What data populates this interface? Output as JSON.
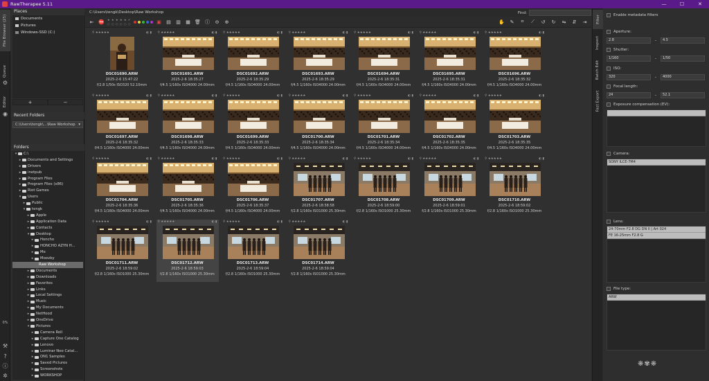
{
  "window": {
    "title": "RawTherapee 5.11",
    "minimize": "—",
    "maximize": "☐",
    "close": "✕"
  },
  "left_tabs": [
    "File Browser (25)",
    "Queue",
    "Editor"
  ],
  "right_tabs": [
    "Filter",
    "Inspect",
    "Batch Edit",
    "Fast Export"
  ],
  "places": {
    "title": "Places",
    "items": [
      "Documents",
      "Pictures",
      "Windows-SSD (C:)"
    ],
    "add": "+",
    "remove": "−"
  },
  "recent": {
    "title": "Recent Folders",
    "value": "C:\\Users\\tengk\\...\\Raw Workshop"
  },
  "folders": {
    "title": "Folders",
    "tree": [
      {
        "label": "C:\\",
        "indent": 0,
        "open": true
      },
      {
        "label": "Documents and Settings",
        "indent": 1
      },
      {
        "label": "Drivers",
        "indent": 1
      },
      {
        "label": "inetpub",
        "indent": 1
      },
      {
        "label": "Program Files",
        "indent": 1
      },
      {
        "label": "Program Files (x86)",
        "indent": 1
      },
      {
        "label": "Riot Games",
        "indent": 1
      },
      {
        "label": "Users",
        "indent": 1,
        "open": true
      },
      {
        "label": "Public",
        "indent": 2
      },
      {
        "label": "tengk",
        "indent": 2,
        "open": true
      },
      {
        "label": "Apple",
        "indent": 3
      },
      {
        "label": "Application Data",
        "indent": 3
      },
      {
        "label": "Contacts",
        "indent": 3
      },
      {
        "label": "Desktop",
        "indent": 3,
        "open": true
      },
      {
        "label": "Honcho",
        "indent": 4
      },
      {
        "label": "HONCHO AZYN H...",
        "indent": 4
      },
      {
        "label": "Me",
        "indent": 4
      },
      {
        "label": "Moovby",
        "indent": 4
      },
      {
        "label": "Raw Workshop",
        "indent": 5,
        "selected": true
      },
      {
        "label": "Documents",
        "indent": 3
      },
      {
        "label": "Downloads",
        "indent": 3
      },
      {
        "label": "Favorites",
        "indent": 3
      },
      {
        "label": "Links",
        "indent": 3
      },
      {
        "label": "Local Settings",
        "indent": 3
      },
      {
        "label": "Music",
        "indent": 3
      },
      {
        "label": "My Documents",
        "indent": 3
      },
      {
        "label": "NetHood",
        "indent": 3
      },
      {
        "label": "OneDrive",
        "indent": 3
      },
      {
        "label": "Pictures",
        "indent": 3,
        "open": true
      },
      {
        "label": "Camera Roll",
        "indent": 4
      },
      {
        "label": "Capture One Catalog",
        "indent": 4
      },
      {
        "label": "Lenovo",
        "indent": 4
      },
      {
        "label": "Luminar Neo Catal...",
        "indent": 4
      },
      {
        "label": "ON1 Samples",
        "indent": 4
      },
      {
        "label": "Saved Pictures",
        "indent": 4
      },
      {
        "label": "Screenshots",
        "indent": 4
      },
      {
        "label": "WORKSHOP",
        "indent": 4
      }
    ]
  },
  "progress": "0%",
  "browser": {
    "path": "C:\\Users\\tengk\\Desktop\\Raw Workshop",
    "find_label": "Find:"
  },
  "thumbnails": [
    {
      "name": "DSC01690.ARW",
      "date": "2025-2-6 15:47:22",
      "exif": "f/2.8 1/50s ISO320 52.10mm",
      "scene": "portrait"
    },
    {
      "name": "DSC01691.ARW",
      "date": "2025-2-6 18:35:27",
      "exif": "f/4.5 1/160s ISO4000 24.00mm",
      "scene": "crowd"
    },
    {
      "name": "DSC01692.ARW",
      "date": "2025-2-6 18:35:29",
      "exif": "f/4.5 1/160s ISO4000 24.00mm",
      "scene": "crowd"
    },
    {
      "name": "DSC01693.ARW",
      "date": "2025-2-6 18:35:29",
      "exif": "f/4.5 1/160s ISO4000 24.00mm",
      "scene": "crowd"
    },
    {
      "name": "DSC01694.ARW",
      "date": "2025-2-6 18:35:31",
      "exif": "f/4.5 1/160s ISO4000 24.00mm",
      "scene": "crowd"
    },
    {
      "name": "DSC01695.ARW",
      "date": "2025-2-6 18:35:31",
      "exif": "f/4.5 1/160s ISO4000 24.00mm",
      "scene": "crowd"
    },
    {
      "name": "DSC01696.ARW",
      "date": "2025-2-6 18:35:32",
      "exif": "f/4.5 1/160s ISO4000 24.00mm",
      "scene": "crowd"
    },
    {
      "name": "DSC01697.ARW",
      "date": "2025-2-6 18:35:32",
      "exif": "f/4.5 1/160s ISO4000 24.00mm",
      "scene": "crowd"
    },
    {
      "name": "DSC01698.ARW",
      "date": "2025-2-6 18:35:33",
      "exif": "f/4.5 1/160s ISO4000 24.00mm",
      "scene": "crowd"
    },
    {
      "name": "DSC01699.ARW",
      "date": "2025-2-6 18:35:33",
      "exif": "f/4.5 1/160s ISO4000 24.00mm",
      "scene": "crowd"
    },
    {
      "name": "DSC01700.ARW",
      "date": "2025-2-6 18:35:34",
      "exif": "f/4.5 1/160s ISO4000 24.00mm",
      "scene": "crowd"
    },
    {
      "name": "DSC01701.ARW",
      "date": "2025-2-6 18:35:34",
      "exif": "f/4.5 1/160s ISO4000 24.00mm",
      "scene": "crowd"
    },
    {
      "name": "DSC01702.ARW",
      "date": "2025-2-6 18:35:35",
      "exif": "f/4.5 1/160s ISO4000 24.00mm",
      "scene": "crowd"
    },
    {
      "name": "DSC01703.ARW",
      "date": "2025-2-6 18:35:35",
      "exif": "f/4.5 1/160s ISO4000 24.00mm",
      "scene": "crowd"
    },
    {
      "name": "DSC01704.ARW",
      "date": "2025-2-6 18:35:36",
      "exif": "f/4.5 1/160s ISO4000 24.00mm",
      "scene": "crowd"
    },
    {
      "name": "DSC01705.ARW",
      "date": "2025-2-6 18:35:36",
      "exif": "f/4.5 1/160s ISO4000 24.00mm",
      "scene": "crowd"
    },
    {
      "name": "DSC01706.ARW",
      "date": "2025-2-6 18:35:37",
      "exif": "f/4.5 1/160s ISO4000 24.00mm",
      "scene": "crowd"
    },
    {
      "name": "DSC01707.ARW",
      "date": "2025-2-6 18:58:58",
      "exif": "f/2.8 1/160s ISO1000 25.30mm",
      "scene": "stage"
    },
    {
      "name": "DSC01708.ARW",
      "date": "2025-2-6 18:59:00",
      "exif": "f/2.8 1/160s ISO1000 25.30mm",
      "scene": "stage"
    },
    {
      "name": "DSC01709.ARW",
      "date": "2025-2-6 18:59:01",
      "exif": "f/2.8 1/160s ISO1000 25.30mm",
      "scene": "stage"
    },
    {
      "name": "DSC01710.ARW",
      "date": "2025-2-6 18:59:02",
      "exif": "f/2.8 1/160s ISO1000 25.30mm",
      "scene": "stage"
    },
    {
      "name": "DSC01711.ARW",
      "date": "2025-2-6 18:59:02",
      "exif": "f/2.8 1/160s ISO1000 25.30mm",
      "scene": "stage"
    },
    {
      "name": "DSC01712.ARW",
      "date": "2025-2-6 18:59:03",
      "exif": "f/2.8 1/160s ISO1000 25.30mm",
      "scene": "stage",
      "selected": true
    },
    {
      "name": "DSC01713.ARW",
      "date": "2025-2-6 18:59:04",
      "exif": "f/2.8 1/160s ISO1000 25.30mm",
      "scene": "stage"
    },
    {
      "name": "DSC01714.ARW",
      "date": "2025-2-6 18:59:04",
      "exif": "f/2.8 1/160s ISO1000 25.30mm",
      "scene": "stage"
    }
  ],
  "filter": {
    "enable_label": "Enable metadata filters",
    "aperture": {
      "label": "Aperture:",
      "min": "2.8",
      "max": "4.5"
    },
    "shutter": {
      "label": "Shutter:",
      "min": "1/160",
      "max": "1/50"
    },
    "iso": {
      "label": "ISO:",
      "min": "320",
      "max": "4000"
    },
    "focal": {
      "label": "Focal length:",
      "min": "24",
      "max": "52.1"
    },
    "expcomp": {
      "label": "Exposure compensation (EV):"
    },
    "camera": {
      "label": "Camera:",
      "items": [
        "SONY ILCE-7M4"
      ]
    },
    "lens": {
      "label": "Lens:",
      "items": [
        "24-70mm F2.8 DG DN II | Art 024",
        "FE 16-25mm F2.8 G"
      ]
    },
    "filetype": {
      "label": "File type:",
      "items": [
        "ARW"
      ]
    },
    "dash": "-"
  },
  "colors": {
    "titlebar": "#5b1a8a",
    "selection": "#6b6b6b"
  }
}
